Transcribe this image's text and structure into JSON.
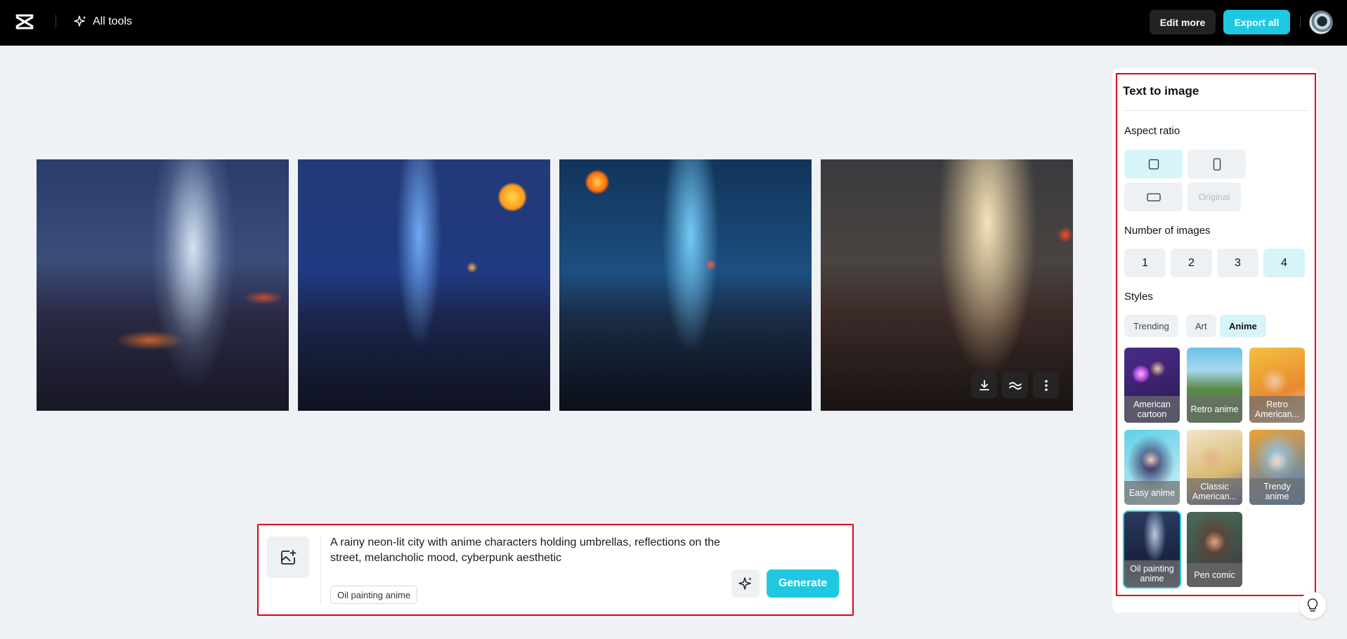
{
  "topbar": {
    "logo_icon": "capcut-logo-icon",
    "all_tools_label": "All tools",
    "edit_more_label": "Edit more",
    "export_all_label": "Export all",
    "accent_color": "#1fc8e0"
  },
  "gallery": {
    "image_count": 4,
    "actions": [
      "download-icon",
      "wave-icon",
      "more-vertical-icon"
    ]
  },
  "prompt": {
    "text": "A rainy neon-lit city with anime characters holding umbrellas, reflections on the street, melancholic mood, cyberpunk aesthetic",
    "style_chip": "Oil painting anime",
    "generate_label": "Generate"
  },
  "panel": {
    "title": "Text to image",
    "aspect_ratio_label": "Aspect ratio",
    "aspect_ratios": [
      {
        "shape": "square",
        "selected": true
      },
      {
        "shape": "portrait",
        "selected": false
      },
      {
        "shape": "landscape",
        "selected": false
      },
      {
        "label": "Original",
        "disabled": true
      }
    ],
    "number_label": "Number of images",
    "numbers": [
      "1",
      "2",
      "3",
      "4"
    ],
    "selected_number": "4",
    "styles_label": "Styles",
    "style_tabs": [
      "Trending",
      "Art",
      "Anime"
    ],
    "selected_tab": "Anime",
    "styles": [
      {
        "label": "American cartoon"
      },
      {
        "label": "Retro anime"
      },
      {
        "label": "Retro American..."
      },
      {
        "label": "Easy anime"
      },
      {
        "label": "Classic American..."
      },
      {
        "label": "Trendy anime"
      },
      {
        "label": "Oil painting anime",
        "selected": true
      },
      {
        "label": "Pen comic"
      }
    ]
  }
}
